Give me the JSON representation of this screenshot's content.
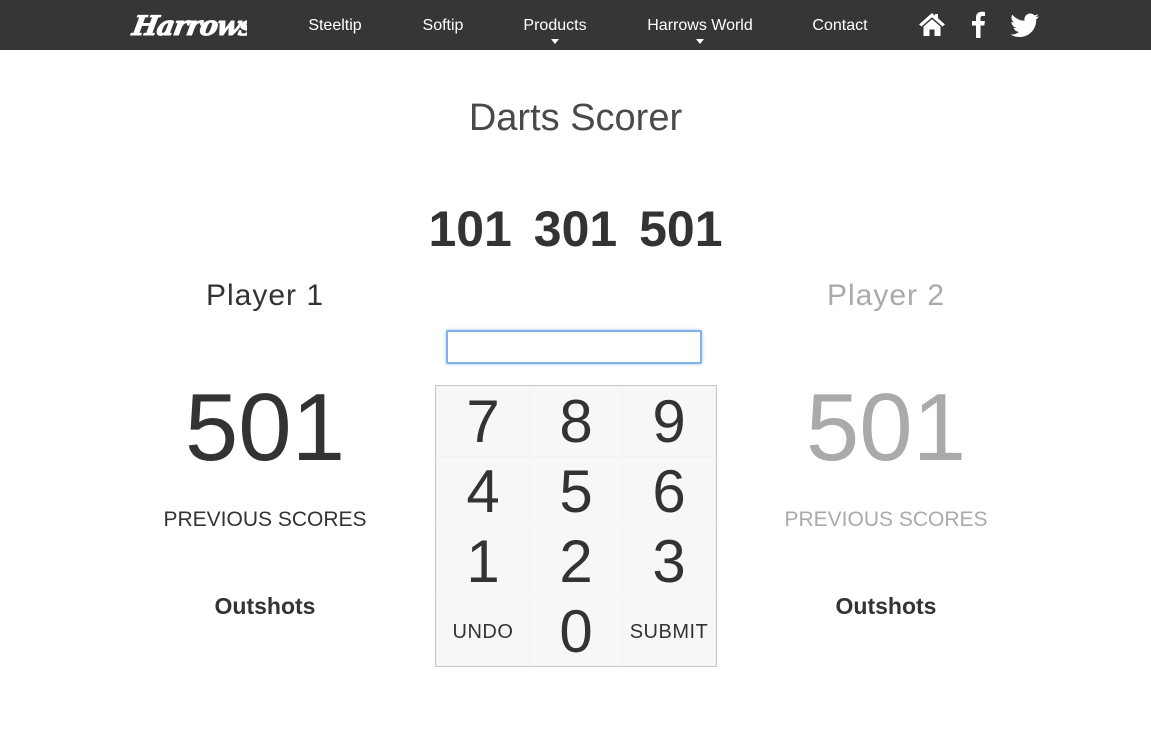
{
  "nav": {
    "logo_text": "Harrows",
    "items": [
      {
        "label": "Steeltip",
        "has_dropdown": false
      },
      {
        "label": "Softip",
        "has_dropdown": false
      },
      {
        "label": "Products",
        "has_dropdown": true
      },
      {
        "label": "Harrows World",
        "has_dropdown": true
      },
      {
        "label": "Contact",
        "has_dropdown": false
      }
    ],
    "icons": [
      "home-icon",
      "facebook-icon",
      "twitter-icon"
    ],
    "background_color": "#363636"
  },
  "page": {
    "title": "Darts Scorer"
  },
  "game_modes": [
    "101",
    "301",
    "501"
  ],
  "score_input": {
    "value": "",
    "placeholder": ""
  },
  "players": [
    {
      "name": "Player 1",
      "score": "501",
      "previous_scores_label": "PREVIOUS SCORES",
      "outshots_label": "Outshots",
      "active": true
    },
    {
      "name": "Player 2",
      "score": "501",
      "previous_scores_label": "PREVIOUS SCORES",
      "outshots_label": "Outshots",
      "active": false
    }
  ],
  "keypad": {
    "keys": [
      "7",
      "8",
      "9",
      "4",
      "5",
      "6",
      "1",
      "2",
      "3",
      "UNDO",
      "0",
      "SUBMIT"
    ]
  },
  "colors": {
    "active_text": "#333333",
    "inactive_text": "#aaaaaa",
    "input_focus_border": "#7fb2e8"
  }
}
